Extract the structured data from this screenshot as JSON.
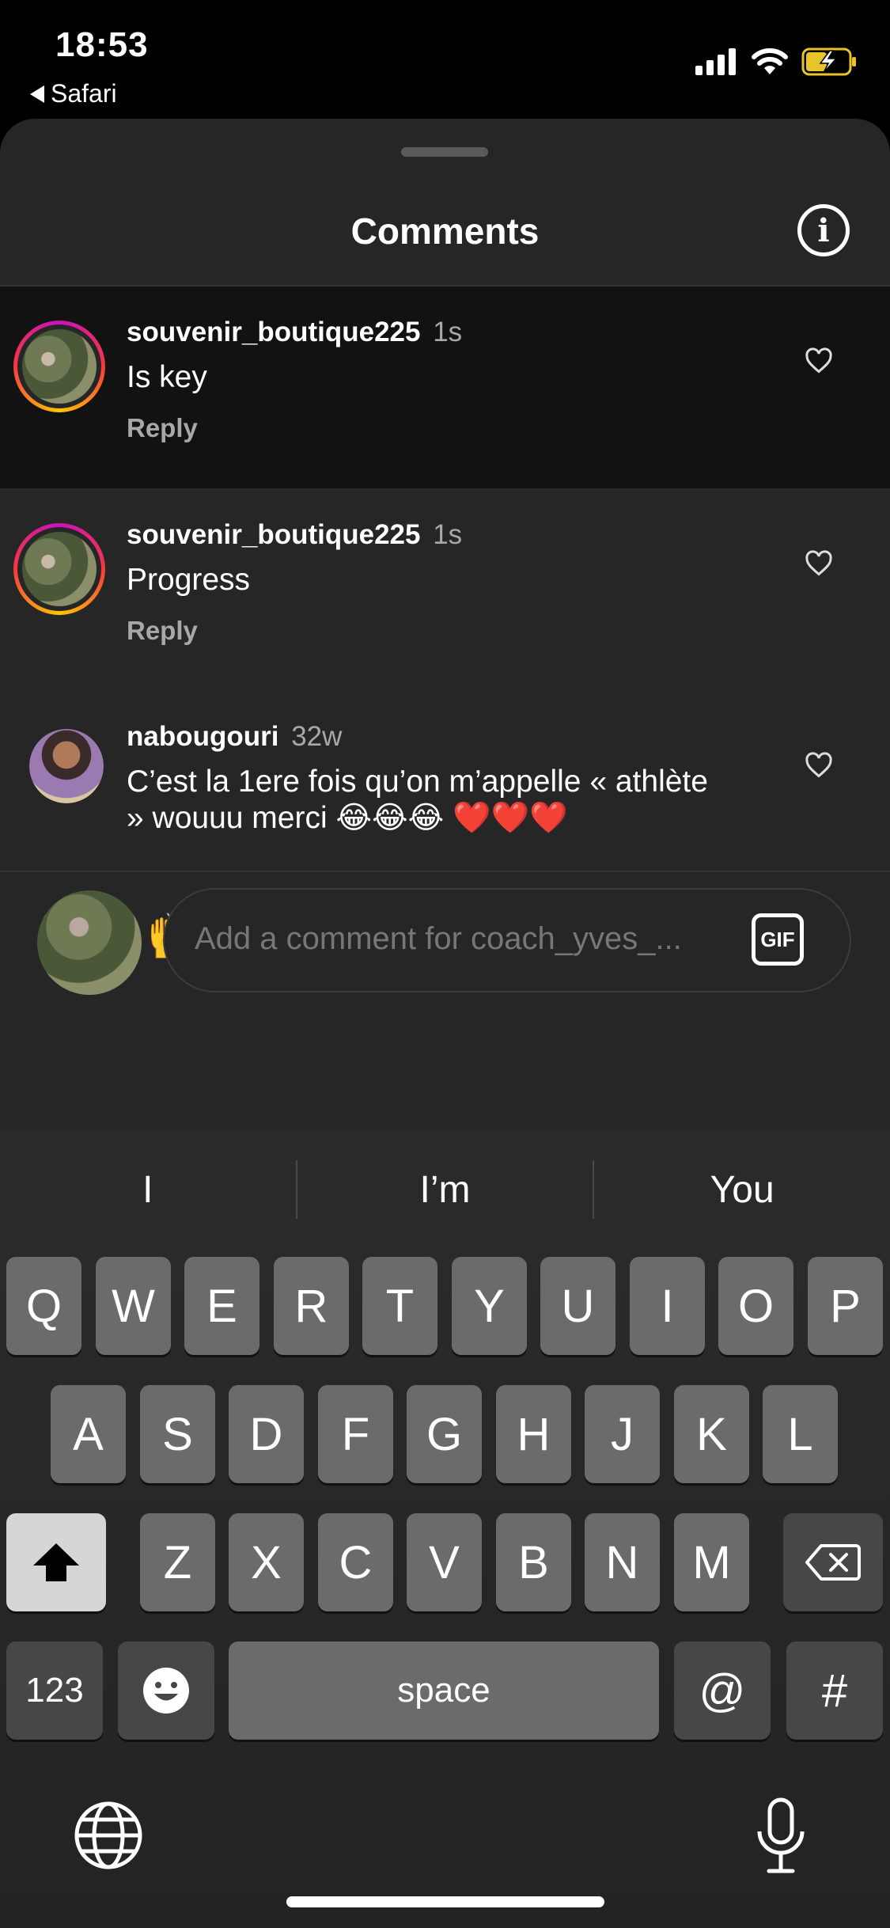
{
  "status_bar": {
    "time": "18:53",
    "back_app": "Safari"
  },
  "sheet": {
    "title": "Comments"
  },
  "comments": [
    {
      "user": "souvenir_boutique225",
      "time": "1s",
      "text": "Is key",
      "reply": "Reply",
      "highlighted": true
    },
    {
      "user": "souvenir_boutique225",
      "time": "1s",
      "text": "Progress",
      "reply": "Reply",
      "highlighted": false
    },
    {
      "user": "nabougouri",
      "time": "32w",
      "text": "C’est la 1ere fois qu’on m’appelle « athlète » wouuu merci 😂😂😂 ❤️❤️❤️",
      "highlighted": false
    }
  ],
  "quick_emojis": [
    "❤️",
    "🙌",
    "🔥",
    "👏",
    "😢",
    "😍",
    "😮",
    "😂"
  ],
  "compose": {
    "placeholder": "Add a comment for coach_yves_...",
    "gif": "GIF"
  },
  "keyboard": {
    "suggestions": [
      "I",
      "I’m",
      "You"
    ],
    "row1": [
      "Q",
      "W",
      "E",
      "R",
      "T",
      "Y",
      "U",
      "I",
      "O",
      "P"
    ],
    "row2": [
      "A",
      "S",
      "D",
      "F",
      "G",
      "H",
      "J",
      "K",
      "L"
    ],
    "row3": [
      "Z",
      "X",
      "C",
      "V",
      "B",
      "N",
      "M"
    ],
    "numbers": "123",
    "space": "space",
    "at": "@",
    "hash": "#"
  },
  "colors": {
    "sheet": "#262626",
    "highlight": "#121212",
    "key": "#6b6b6b",
    "muted": "#a8a8a8"
  }
}
